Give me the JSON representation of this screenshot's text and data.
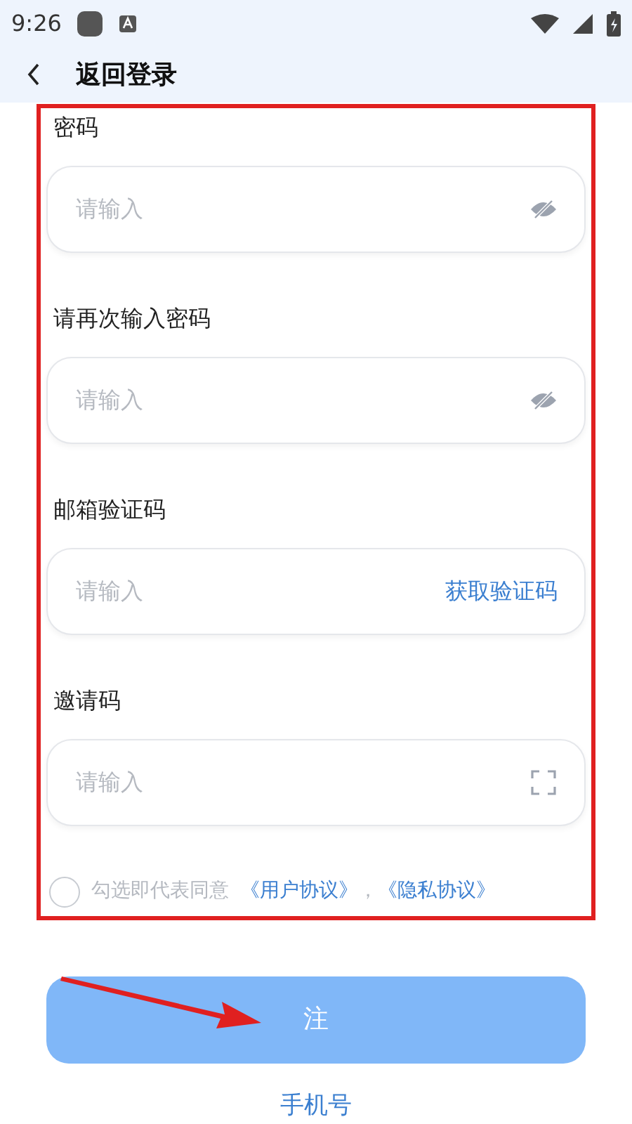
{
  "status_bar": {
    "time": "9:26"
  },
  "header": {
    "title": "返回登录"
  },
  "fields": [
    {
      "label": "密码",
      "placeholder": "请输入",
      "kind": "password"
    },
    {
      "label": "请再次输入密码",
      "placeholder": "请输入",
      "kind": "password"
    },
    {
      "label": "邮箱验证码",
      "placeholder": "请输入",
      "kind": "code",
      "action": "获取验证码"
    },
    {
      "label": "邀请码",
      "placeholder": "请输入",
      "kind": "scan"
    }
  ],
  "agreement": {
    "checked": false,
    "text": "勾选即代表同意",
    "links": [
      "《用户协议》",
      "《隐私协议》"
    ],
    "separator": "，"
  },
  "submit_button": {
    "label": "注"
  },
  "footer_link": {
    "label": "手机号"
  }
}
